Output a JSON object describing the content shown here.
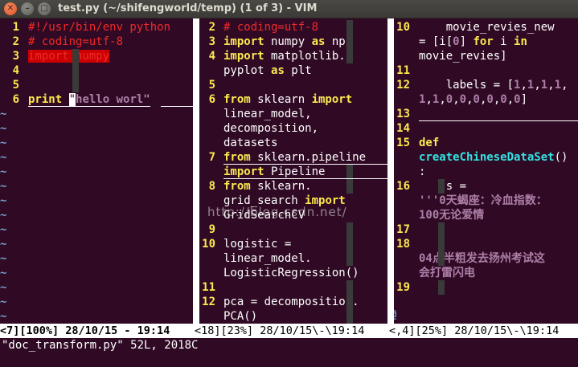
{
  "window": {
    "title": "test.py (~/shifengworld/temp) (1 of 3) - VIM",
    "close_glyph": "✕",
    "min_glyph": "–",
    "max_glyph": "□"
  },
  "pane1": {
    "lines": [
      {
        "n": "1",
        "text": "#!/usr/bin/env python"
      },
      {
        "n": "2",
        "text": "# coding=utf-8"
      },
      {
        "n": "3",
        "kw": "import",
        "rest": " numpy"
      },
      {
        "n": "4",
        "text": ""
      },
      {
        "n": "5",
        "text": ""
      },
      {
        "n": "6",
        "pre": "print ",
        "cursor": "\"",
        "str": "hello worl\""
      }
    ],
    "tilde": "~",
    "status": "<7][100%] 28/10/15 - 19:14"
  },
  "pane2": {
    "lines": [
      {
        "n": "2",
        "parts": [
          {
            "c": "cm",
            "t": "# coding=utf-8"
          }
        ]
      },
      {
        "n": "3",
        "parts": [
          {
            "c": "kwy",
            "t": "import"
          },
          {
            "c": "",
            "t": " numpy "
          },
          {
            "c": "kwy",
            "t": "as"
          },
          {
            "c": "",
            "t": " np"
          }
        ]
      },
      {
        "n": "4",
        "parts": [
          {
            "c": "kwy",
            "t": "import"
          },
          {
            "c": "",
            "t": " matplotlib."
          }
        ]
      },
      {
        "n": "",
        "parts": [
          {
            "c": "",
            "t": "pyplot "
          },
          {
            "c": "kwy",
            "t": "as"
          },
          {
            "c": "",
            "t": " plt"
          }
        ]
      },
      {
        "n": "5",
        "parts": []
      },
      {
        "n": "6",
        "parts": [
          {
            "c": "kwy",
            "t": "from"
          },
          {
            "c": "",
            "t": " sklearn "
          },
          {
            "c": "kwy",
            "t": "import"
          }
        ]
      },
      {
        "n": "",
        "parts": [
          {
            "c": "",
            "t": "linear_model,"
          }
        ]
      },
      {
        "n": "",
        "parts": [
          {
            "c": "",
            "t": "decomposition,"
          }
        ]
      },
      {
        "n": "",
        "parts": [
          {
            "c": "",
            "t": "datasets"
          }
        ]
      },
      {
        "n": "7",
        "parts": [
          {
            "c": "kwy",
            "t": "from"
          },
          {
            "c": "",
            "t": " sklearn.pipeline"
          }
        ]
      },
      {
        "n": "",
        "parts": [
          {
            "c": "kwy",
            "t": "import"
          },
          {
            "c": "",
            "t": " Pipeline"
          }
        ]
      },
      {
        "n": "8",
        "parts": [
          {
            "c": "kwy",
            "t": "from"
          },
          {
            "c": "",
            "t": " sklearn."
          }
        ]
      },
      {
        "n": "",
        "parts": [
          {
            "c": "",
            "t": "grid_search "
          },
          {
            "c": "kwy",
            "t": "import"
          }
        ]
      },
      {
        "n": "",
        "parts": [
          {
            "c": "",
            "t": "GridSearchCV"
          }
        ]
      },
      {
        "n": "9",
        "parts": []
      },
      {
        "n": "10",
        "parts": [
          {
            "c": "",
            "t": "logistic ="
          }
        ]
      },
      {
        "n": "",
        "parts": [
          {
            "c": "",
            "t": "linear_model."
          }
        ]
      },
      {
        "n": "",
        "parts": [
          {
            "c": "",
            "t": "LogisticRegression()"
          }
        ]
      },
      {
        "n": "11",
        "parts": []
      },
      {
        "n": "12",
        "parts": [
          {
            "c": "",
            "t": "pca = decomposition."
          }
        ]
      },
      {
        "n": "",
        "parts": [
          {
            "c": "",
            "t": "PCA()"
          }
        ]
      }
    ],
    "status": "<18][23%] 28/10/15\\-\\19:14"
  },
  "pane3": {
    "lines": [
      {
        "n": "10",
        "parts": [
          {
            "c": "",
            "t": "    movie_revies_new"
          }
        ]
      },
      {
        "n": "",
        "parts": [
          {
            "c": "",
            "t": "= [i["
          },
          {
            "c": "num",
            "t": "0"
          },
          {
            "c": "",
            "t": "] "
          },
          {
            "c": "kwy",
            "t": "for"
          },
          {
            "c": "",
            "t": " i "
          },
          {
            "c": "kwy",
            "t": "in"
          }
        ]
      },
      {
        "n": "",
        "parts": [
          {
            "c": "",
            "t": "movie_revies]"
          }
        ]
      },
      {
        "n": "11",
        "parts": []
      },
      {
        "n": "12",
        "parts": [
          {
            "c": "",
            "t": "    labels = ["
          },
          {
            "c": "num",
            "t": "1"
          },
          {
            "c": "",
            "t": ","
          },
          {
            "c": "num",
            "t": "1"
          },
          {
            "c": "",
            "t": ","
          },
          {
            "c": "num",
            "t": "1"
          },
          {
            "c": "",
            "t": ","
          },
          {
            "c": "num",
            "t": "1"
          },
          {
            "c": "",
            "t": ","
          }
        ]
      },
      {
        "n": "",
        "parts": [
          {
            "c": "num",
            "t": "1"
          },
          {
            "c": "",
            "t": ","
          },
          {
            "c": "num",
            "t": "1"
          },
          {
            "c": "",
            "t": ","
          },
          {
            "c": "num",
            "t": "0"
          },
          {
            "c": "",
            "t": ","
          },
          {
            "c": "num",
            "t": "0"
          },
          {
            "c": "",
            "t": ","
          },
          {
            "c": "num",
            "t": "0"
          },
          {
            "c": "",
            "t": ","
          },
          {
            "c": "num",
            "t": "0"
          },
          {
            "c": "",
            "t": ","
          },
          {
            "c": "num",
            "t": "0"
          },
          {
            "c": "",
            "t": ","
          },
          {
            "c": "num",
            "t": "0"
          },
          {
            "c": "",
            "t": "]"
          }
        ]
      },
      {
        "n": "13",
        "parts": []
      },
      {
        "n": "14",
        "parts": []
      },
      {
        "n": "15",
        "parts": [
          {
            "c": "def",
            "t": "def"
          }
        ]
      },
      {
        "n": "",
        "parts": [
          {
            "c": "fn",
            "t": "createChineseDataSet"
          },
          {
            "c": "",
            "t": "()"
          }
        ]
      },
      {
        "n": "",
        "parts": [
          {
            "c": "",
            "t": ":"
          }
        ]
      },
      {
        "n": "16",
        "parts": [
          {
            "c": "",
            "t": "    s ="
          }
        ]
      },
      {
        "n": "",
        "parts": [
          {
            "c": "str",
            "t": "'''0天蝎座：冷血指数："
          }
        ]
      },
      {
        "n": "",
        "parts": [
          {
            "c": "str",
            "t": "100无论爱情"
          }
        ]
      },
      {
        "n": "17",
        "parts": []
      },
      {
        "n": "18",
        "parts": []
      },
      {
        "n": "",
        "parts": [
          {
            "c": "str",
            "t": "04点半粗发去扬州考试这"
          }
        ]
      },
      {
        "n": "",
        "parts": [
          {
            "c": "str",
            "t": "会打雷闪电"
          }
        ]
      },
      {
        "n": "19",
        "parts": []
      }
    ],
    "at": "@",
    "status": "<,4][25%] 28/10/15\\-\\19:14"
  },
  "watermark": "http://blog.csdn.net/",
  "message": "\"doc_transform.py\" 52L, 2018C"
}
